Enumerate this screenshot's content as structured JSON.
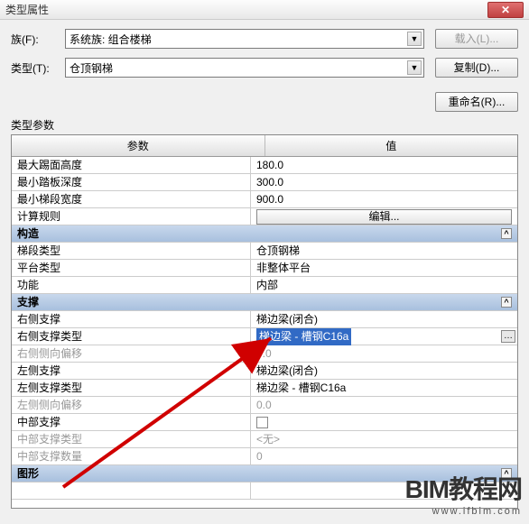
{
  "window": {
    "title": "类型属性",
    "close": "✕"
  },
  "form": {
    "family_label": "族(F):",
    "family_value": "系统族: 组合楼梯",
    "type_label": "类型(T):",
    "type_value": "仓顶钢梯"
  },
  "buttons": {
    "load": "载入(L)...",
    "duplicate": "复制(D)...",
    "rename": "重命名(R)..."
  },
  "section_label": "类型参数",
  "headers": {
    "param": "参数",
    "value": "值"
  },
  "rows": {
    "r1": {
      "p": "最大踢面高度",
      "v": "180.0"
    },
    "r2": {
      "p": "最小踏板深度",
      "v": "300.0"
    },
    "r3": {
      "p": "最小梯段宽度",
      "v": "900.0"
    },
    "r4": {
      "p": "计算规则",
      "v_btn": "编辑..."
    },
    "g1": "构造",
    "r5": {
      "p": "梯段类型",
      "v": "仓顶钢梯"
    },
    "r6": {
      "p": "平台类型",
      "v": "非整体平台"
    },
    "r7": {
      "p": "功能",
      "v": "内部"
    },
    "g2": "支撑",
    "r8": {
      "p": "右侧支撑",
      "v": "梯边梁(闭合)"
    },
    "r9": {
      "p": "右侧支撑类型",
      "v": "梯边梁 - 槽钢C16a"
    },
    "r10": {
      "p": "右侧侧向偏移",
      "v": "0.0"
    },
    "r11": {
      "p": "左侧支撑",
      "v": "梯边梁(闭合)"
    },
    "r12": {
      "p": "左侧支撑类型",
      "v": "梯边梁 - 槽钢C16a"
    },
    "r13": {
      "p": "左侧侧向偏移",
      "v": "0.0"
    },
    "r14": {
      "p": "中部支撑",
      "v": ""
    },
    "r15": {
      "p": "中部支撑类型",
      "v": "<无>"
    },
    "r16": {
      "p": "中部支撑数量",
      "v": "0"
    },
    "g3": "图形"
  },
  "watermark": {
    "main": "BIM教程网",
    "sub": "www.ifbim.com"
  }
}
